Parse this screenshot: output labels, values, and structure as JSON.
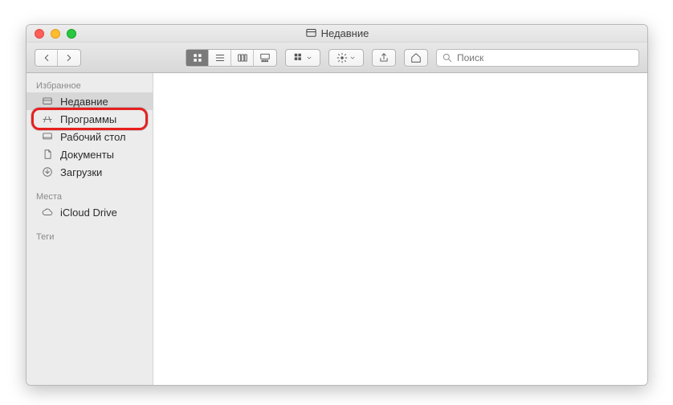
{
  "window": {
    "title": "Недавние"
  },
  "toolbar": {
    "search_placeholder": "Поиск"
  },
  "sidebar": {
    "sections": {
      "favorites": {
        "title": "Избранное"
      },
      "locations": {
        "title": "Места"
      },
      "tags": {
        "title": "Теги"
      }
    },
    "items": [
      {
        "label": "Недавние"
      },
      {
        "label": "Программы"
      },
      {
        "label": "Рабочий стол"
      },
      {
        "label": "Документы"
      },
      {
        "label": "Загрузки"
      },
      {
        "label": "iCloud Drive"
      }
    ]
  }
}
